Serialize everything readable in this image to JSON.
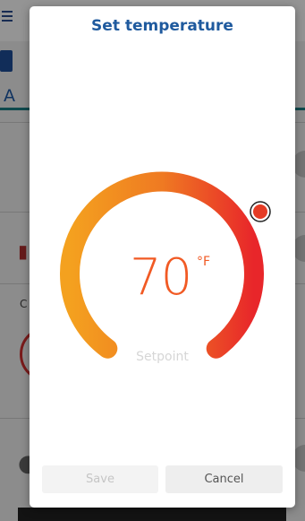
{
  "dialog": {
    "title": "Set temperature",
    "temperature_value": "70",
    "temperature_unit": "°F",
    "setpoint_label": "Setpoint",
    "save_label": "Save",
    "cancel_label": "Cancel"
  },
  "background_app": {
    "tab_partial_label": "A",
    "section_partial_label": "C"
  },
  "colors": {
    "title_blue": "#1f5a9e",
    "dial_orange": "#f15a24",
    "dial_gradient_start": "#f4a11f",
    "dial_gradient_mid": "#ef7a22",
    "dial_gradient_end": "#e8262a",
    "handle_red": "#e53b24"
  },
  "icons": {
    "background_menu": "menu-icon",
    "dial_handle": "dial-handle-icon"
  }
}
